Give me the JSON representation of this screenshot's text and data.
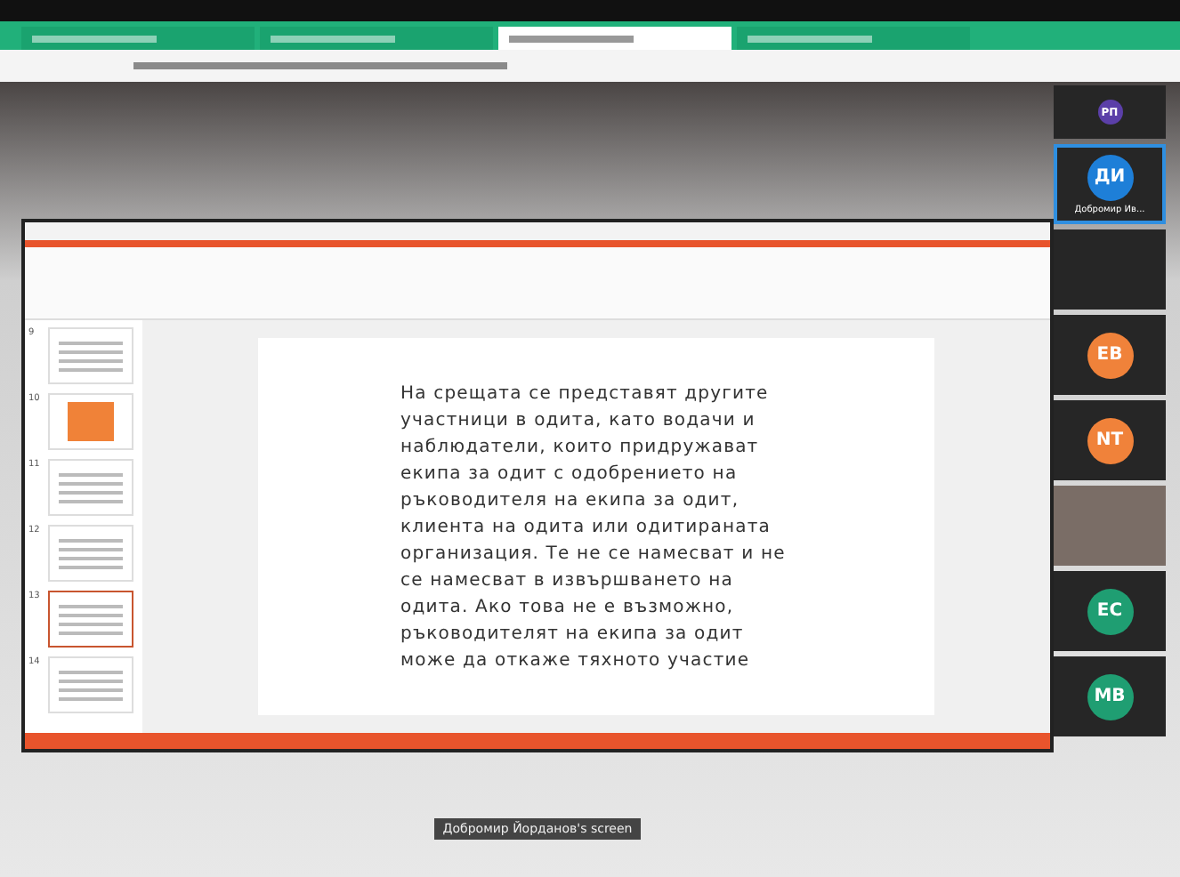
{
  "browser": {
    "tabs": [
      {
        "selected": false
      },
      {
        "selected": false
      },
      {
        "selected": true
      },
      {
        "selected": false
      }
    ]
  },
  "slides": [
    {
      "number": "9",
      "kind": "text",
      "selected": false
    },
    {
      "number": "10",
      "kind": "orange",
      "selected": false
    },
    {
      "number": "11",
      "kind": "text",
      "selected": false
    },
    {
      "number": "12",
      "kind": "text",
      "selected": false
    },
    {
      "number": "13",
      "kind": "text",
      "selected": true
    },
    {
      "number": "14",
      "kind": "text",
      "selected": false
    }
  ],
  "slide_text": "На срещата се представят другите участници в одита, като водачи и наблюдатели, които придружават екипа за одит с одобрението на ръководителя на екипа за одит, клиента на одита или одитираната организация. Те не се намесват и не се намесват в извършването на одита. Ако това не е възможно, ръководителят на екипа за одит може да откаже тяхното участие",
  "participants": [
    {
      "kind": "avatar",
      "initials": "РП",
      "color": "#5b3fa8",
      "selected": false
    },
    {
      "kind": "avatar",
      "initials": "ДИ",
      "color": "#1e7fd8",
      "name": "Добромир Ив...",
      "selected": true
    },
    {
      "kind": "empty",
      "selected": false
    },
    {
      "kind": "avatar",
      "initials": "ЕВ",
      "color": "#f0823a",
      "selected": false
    },
    {
      "kind": "avatar",
      "initials": "NT",
      "color": "#f0823a",
      "selected": false
    },
    {
      "kind": "video",
      "selected": false
    },
    {
      "kind": "avatar",
      "initials": "ЕС",
      "color": "#1f9e72",
      "selected": false
    },
    {
      "kind": "avatar",
      "initials": "МВ",
      "color": "#1f9e72",
      "selected": false
    }
  ],
  "caption": "Добромир Йорданов's screen"
}
